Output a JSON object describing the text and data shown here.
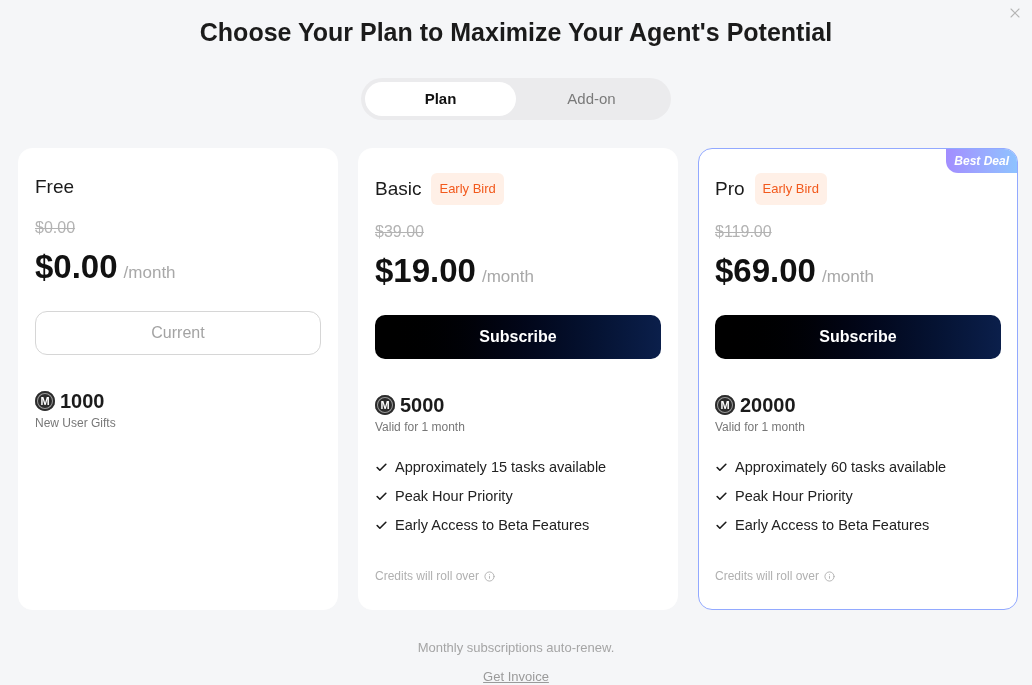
{
  "title": "Choose Your Plan to Maximize Your Agent's Potential",
  "tabs": [
    {
      "label": "Plan",
      "selected": true
    },
    {
      "label": "Add-on",
      "selected": false
    }
  ],
  "plans": [
    {
      "name": "Free",
      "highlighted": false,
      "original_price": "$0.00",
      "price": "$0.00",
      "period": "/month",
      "action": {
        "label": "Current",
        "kind": "current"
      },
      "credits": {
        "symbol": "M",
        "amount": "1000",
        "note": "New User Gifts"
      }
    },
    {
      "name": "Basic",
      "badge": "Early Bird",
      "highlighted": false,
      "original_price": "$39.00",
      "price": "$19.00",
      "period": "/month",
      "action": {
        "label": "Subscribe",
        "kind": "subscribe"
      },
      "credits": {
        "symbol": "M",
        "amount": "5000",
        "note": "Valid for 1 month"
      },
      "features": [
        "Approximately 15 tasks available",
        "Peak Hour Priority",
        "Early Access to Beta Features"
      ],
      "footnote": "Credits will roll over"
    },
    {
      "name": "Pro",
      "badge": "Early Bird",
      "highlighted": true,
      "ribbon": "Best Deal",
      "original_price": "$119.00",
      "price": "$69.00",
      "period": "/month",
      "action": {
        "label": "Subscribe",
        "kind": "subscribe"
      },
      "credits": {
        "symbol": "M",
        "amount": "20000",
        "note": "Valid for 1 month"
      },
      "features": [
        "Approximately 60 tasks available",
        "Peak Hour Priority",
        "Early Access to Beta Features"
      ],
      "footnote": "Credits will roll over"
    }
  ],
  "footer": {
    "note": "Monthly subscriptions auto-renew.",
    "link": "Get Invoice"
  }
}
